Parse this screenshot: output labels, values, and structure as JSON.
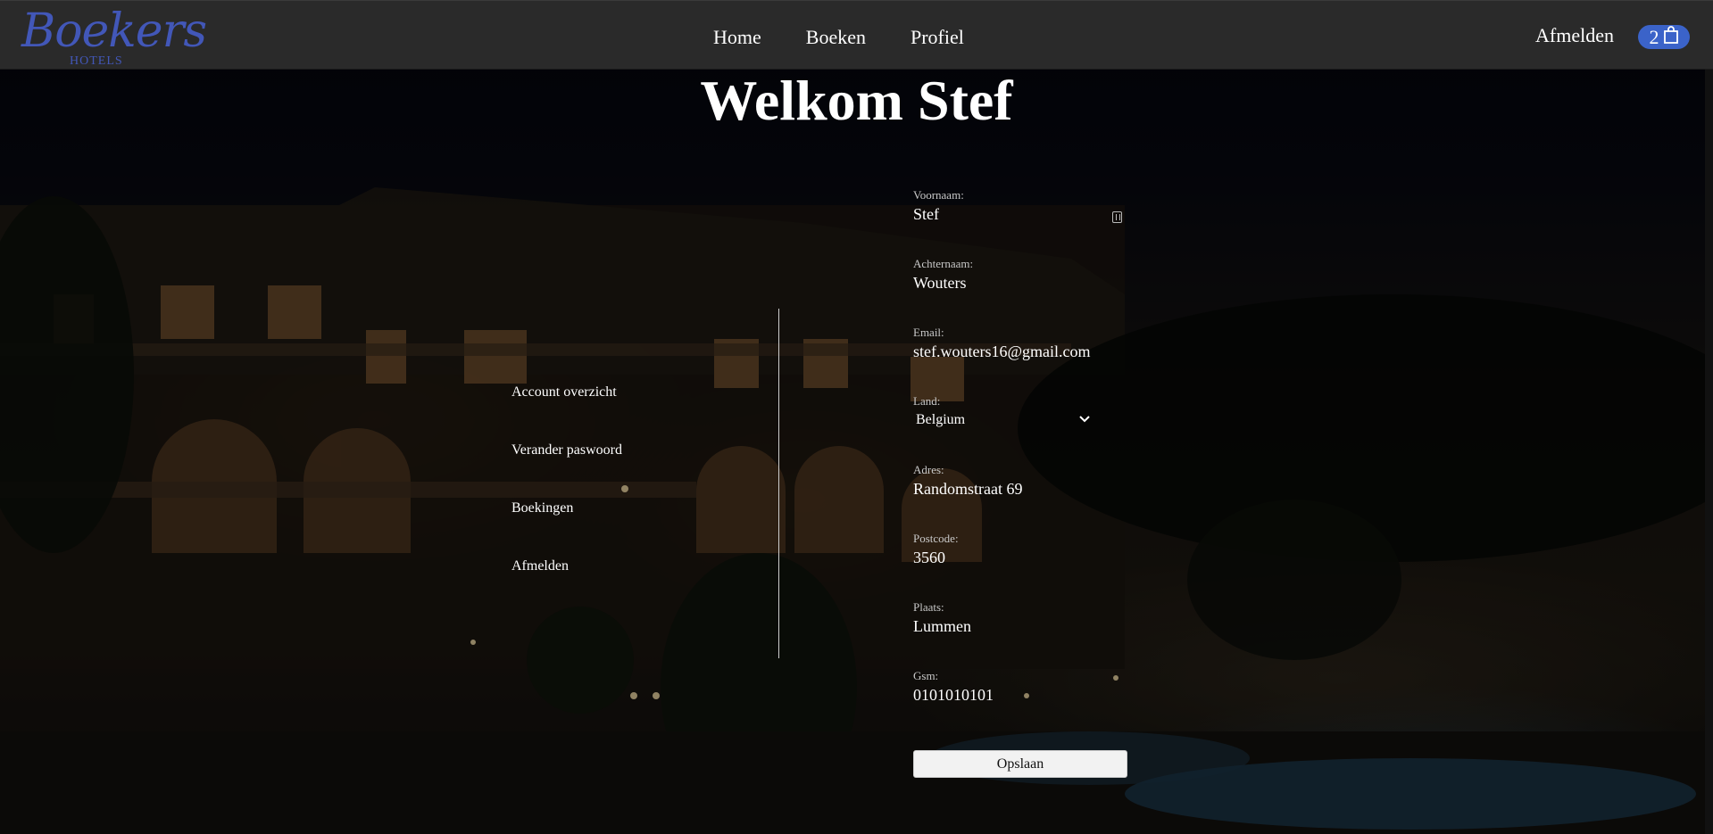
{
  "brand": {
    "name": "Boekers",
    "sub": "HOTELS"
  },
  "nav": {
    "home": "Home",
    "book": "Boeken",
    "profile": "Profiel",
    "logout": "Afmelden",
    "cart_count": "2"
  },
  "page": {
    "title": "Welkom Stef"
  },
  "side_menu": [
    {
      "label": "Account overzicht"
    },
    {
      "label": "Verander paswoord"
    },
    {
      "label": "Boekingen"
    },
    {
      "label": "Afmelden"
    }
  ],
  "form": {
    "first_name": {
      "label": "Voornaam:",
      "value": "Stef"
    },
    "last_name": {
      "label": "Achternaam:",
      "value": "Wouters"
    },
    "email": {
      "label": "Email:",
      "value": "stef.wouters16@gmail.com"
    },
    "country": {
      "label": "Land:",
      "value": "Belgium"
    },
    "address": {
      "label": "Adres:",
      "value": "Randomstraat 69"
    },
    "postcode": {
      "label": "Postcode:",
      "value": "3560"
    },
    "city": {
      "label": "Plaats:",
      "value": "Lummen"
    },
    "phone": {
      "label": "Gsm:",
      "value": "0101010101"
    },
    "save_label": "Opslaan"
  },
  "icons": {
    "cart": "shopping-bag-icon",
    "dropdown": "chevron-down-icon",
    "autofill": "autofill-key-icon"
  }
}
